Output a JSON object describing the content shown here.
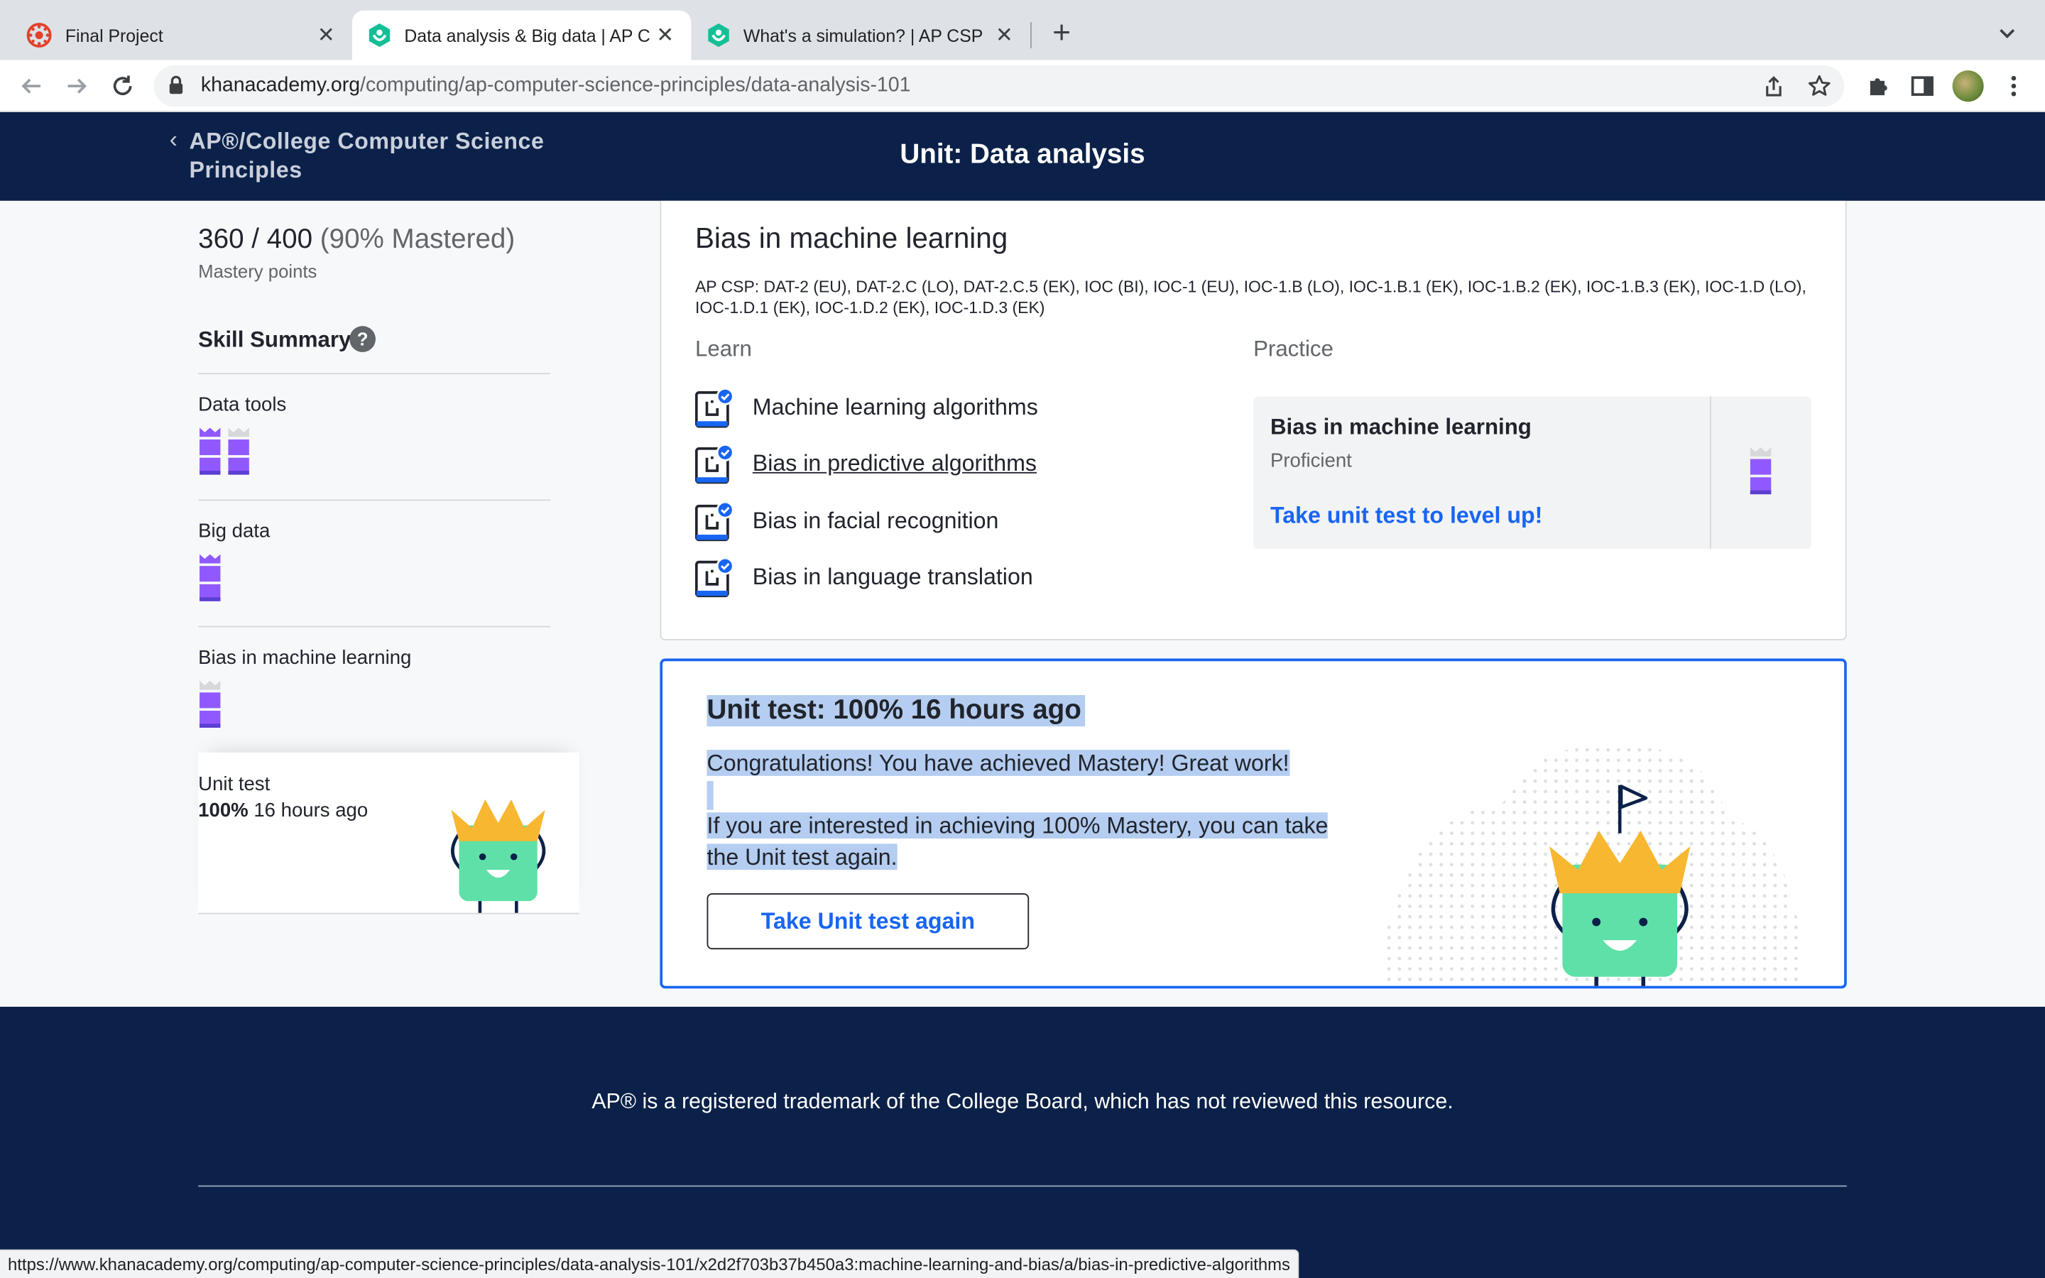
{
  "browser": {
    "tabs": [
      {
        "title": "Final Project",
        "icon": "canvas-icon"
      },
      {
        "title": "Data analysis & Big data | AP C",
        "icon": "khan-academy-icon",
        "active": true
      },
      {
        "title": "What's a simulation? | AP CSP",
        "icon": "khan-academy-icon"
      }
    ],
    "url_host": "khanacademy.org",
    "url_path": "/computing/ap-computer-science-principles/data-analysis-101",
    "status_url": "https://www.khanacademy.org/computing/ap-computer-science-principles/data-analysis-101/x2d2f703b37b450a3:machine-learning-and-bias/a/bias-in-predictive-algorithms"
  },
  "header": {
    "back_link": "AP®/College Computer Science Principles",
    "unit_title": "Unit: Data analysis"
  },
  "sidebar": {
    "points": "360 / 400",
    "points_pct": "(90% Mastered)",
    "points_label": "Mastery points",
    "skill_summary": "Skill Summary",
    "help_glyph": "?",
    "skills": [
      {
        "name": "Data tools",
        "levels": [
          "mastered",
          "proficient"
        ]
      },
      {
        "name": "Big data",
        "levels": [
          "mastered"
        ]
      },
      {
        "name": "Bias in machine learning",
        "levels": [
          "proficient"
        ]
      }
    ],
    "unit_test_label": "Unit test",
    "unit_test_score": "100%",
    "unit_test_time": "16 hours ago"
  },
  "lesson": {
    "title": "Bias in machine learning",
    "codes": "AP CSP: DAT-2 (EU), DAT-2.C (LO), DAT-2.C.5 (EK), IOC (BI), IOC-1 (EU), IOC-1.B (LO), IOC-1.B.1 (EK), IOC-1.B.2 (EK), IOC-1.B.3 (EK), IOC-1.D (LO), IOC-1.D.1 (EK), IOC-1.D.2 (EK), IOC-1.D.3 (EK)",
    "learn_heading": "Learn",
    "practice_heading": "Practice",
    "learn_items": [
      "Machine learning algorithms",
      "Bias in predictive algorithms",
      "Bias in facial recognition",
      "Bias in language translation"
    ],
    "practice": {
      "title": "Bias in machine learning",
      "status": "Proficient",
      "link": "Take unit test to level up!"
    }
  },
  "unit_test": {
    "heading": "Unit test: 100% 16 hours ago",
    "congrats": "Congratulations! You have achieved Mastery! Great work!",
    "info_line1": "If you are interested in achieving 100% Mastery, you can take",
    "info_line2": "the Unit test again.",
    "button": "Take Unit test again"
  },
  "footer": {
    "note": "AP® is a registered trademark of the College Board, which has not reviewed this resource."
  },
  "colors": {
    "navy": "#0b2149",
    "blue": "#1865f2",
    "mastery_purple": "#9059ff",
    "mascot_green": "#5fe0a8",
    "crown_gold": "#f7b731"
  }
}
